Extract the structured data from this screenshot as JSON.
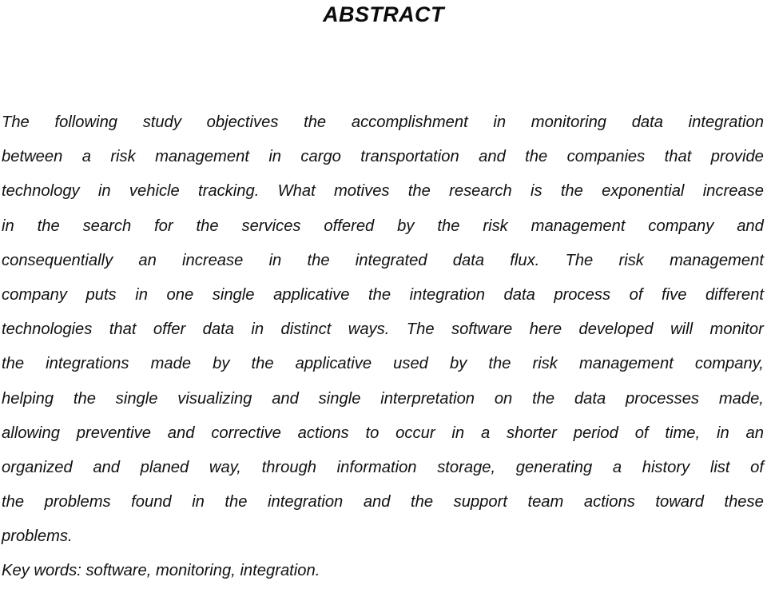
{
  "document": {
    "type": "scanned-paper-page",
    "section_heading": "ABSTRACT",
    "background_color": "#ffffff",
    "text_color": "#111111",
    "abstract_text": "The following study objectives the accomplishment in monitoring data integration between a risk management in cargo transportation and the companies that provide technology in vehicle tracking. What motives the research is the exponential increase in the search for the services offered by the risk management company and consequentially an increase in the integrated data flux. The risk management company puts in one single applicative the integration data process of five different technologies that offer data in distinct ways. The software here developed will monitor the integrations made by the applicative used by the risk management company, helping the single visualizing and single interpretation on the data processes made, allowing preventive and corrective actions to occur in a shorter period of time, in an organized and planed way, through information storage, generating a history list of the problems found in the integration and the support team actions toward these problems.",
    "keywords_line": "Key words: software, monitoring, integration.",
    "lines": [
      {
        "index": 1,
        "align": "justify",
        "text": "The following study objectives the accomplishment in monitoring data integration",
        "words": [
          "The",
          "following",
          "study",
          "objectives",
          "the",
          "accomplishment",
          "in",
          "monitoring",
          "data",
          "integration"
        ]
      },
      {
        "index": 2,
        "align": "justify",
        "text": "between a risk management in cargo transportation and the companies that provide",
        "words": [
          "between",
          "a",
          "risk",
          "management",
          "in",
          "cargo",
          "transportation",
          "and",
          "the",
          "companies",
          "that",
          "provide"
        ]
      },
      {
        "index": 3,
        "align": "justify",
        "text": "technology in vehicle tracking. What motives the research is the exponential increase",
        "words": [
          "technology",
          "in",
          "vehicle",
          "tracking.",
          "What",
          "motives",
          "the",
          "research",
          "is",
          "the",
          "exponential",
          "increase"
        ]
      },
      {
        "index": 4,
        "align": "justify",
        "text": "in the search for the services offered by the risk management company and",
        "words": [
          "in",
          "the",
          "search",
          "for",
          "the",
          "services",
          "offered",
          "by",
          "the",
          "risk",
          "management",
          "company",
          "and"
        ]
      },
      {
        "index": 5,
        "align": "justify",
        "text": "consequentially an increase in the integrated data flux. The risk management",
        "words": [
          "consequentially",
          "an",
          "increase",
          "in",
          "the",
          "integrated",
          "data",
          "flux.",
          "The",
          "risk",
          "management"
        ]
      },
      {
        "index": 6,
        "align": "justify",
        "text": "company puts in one single applicative the integration data process of five different",
        "words": [
          "company",
          "puts",
          "in",
          "one",
          "single",
          "applicative",
          "the",
          "integration",
          "data",
          "process",
          "of",
          "five",
          "different"
        ]
      },
      {
        "index": 7,
        "align": "justify",
        "text": "technologies that offer data in distinct ways. The software here developed will monitor",
        "words": [
          "technologies",
          "that",
          "offer",
          "data",
          "in",
          "distinct",
          "ways.",
          "The",
          "software",
          "here",
          "developed",
          "will",
          "monitor"
        ]
      },
      {
        "index": 8,
        "align": "justify",
        "text": "the integrations made by the applicative used by the risk management company,",
        "words": [
          "the",
          "integrations",
          "made",
          "by",
          "the",
          "applicative",
          "used",
          "by",
          "the",
          "risk",
          "management",
          "company,"
        ]
      },
      {
        "index": 9,
        "align": "justify",
        "text": "helping the single visualizing and single interpretation on the data processes made,",
        "words": [
          "helping",
          "the",
          "single",
          "visualizing",
          "and",
          "single",
          "interpretation",
          "on",
          "the",
          "data",
          "processes",
          "made,"
        ]
      },
      {
        "index": 10,
        "align": "justify",
        "text": "allowing preventive and corrective actions to occur in a shorter period of time, in an",
        "words": [
          "allowing",
          "preventive",
          "and",
          "corrective",
          "actions",
          "to",
          "occur",
          "in",
          "a",
          "shorter",
          "period",
          "of",
          "time,",
          "in",
          "an"
        ]
      },
      {
        "index": 11,
        "align": "justify",
        "text": "organized and planed way, through information storage, generating a history list of",
        "words": [
          "organized",
          "and",
          "planed",
          "way,",
          "through",
          "information",
          "storage,",
          "generating",
          "a",
          "history",
          "list",
          "of"
        ]
      },
      {
        "index": 12,
        "align": "justify",
        "text": "the problems found in the integration and the support team actions toward these",
        "words": [
          "the",
          "problems",
          "found",
          "in",
          "the",
          "integration",
          "and",
          "the",
          "support",
          "team",
          "actions",
          "toward",
          "these"
        ]
      },
      {
        "index": 13,
        "align": "flush",
        "text": "problems.",
        "words": [
          "problems."
        ]
      },
      {
        "index": 14,
        "align": "flush",
        "text": "Key words: software, monitoring, integration.",
        "words": [
          "Key words: software, monitoring, integration."
        ]
      }
    ]
  }
}
